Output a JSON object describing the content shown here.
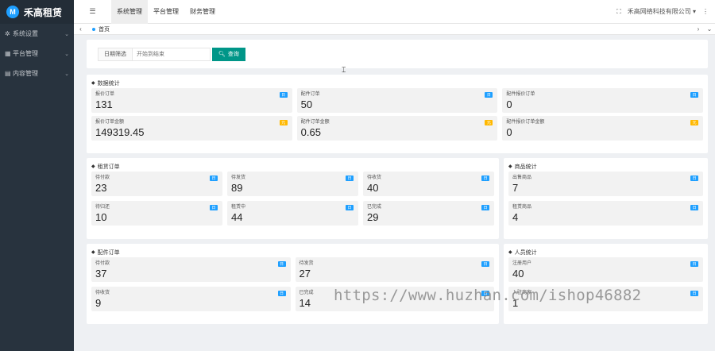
{
  "app": {
    "logo_text": "禾高租赁",
    "logo_mark": "M"
  },
  "sidebar": {
    "items": [
      {
        "label": "系统设置",
        "icon": "gear-icon",
        "glyph": "✲"
      },
      {
        "label": "平台管理",
        "icon": "panel-icon",
        "glyph": "▦"
      },
      {
        "label": "内容管理",
        "icon": "folder-icon",
        "glyph": "▤"
      }
    ]
  },
  "topbar": {
    "menu_glyph": "☰",
    "tabs": [
      "系统管理",
      "平台管理",
      "财务管理"
    ],
    "fullscreen_glyph": "⛶",
    "user": "禾高网络科技有限公司 ▾",
    "more_glyph": "⋮"
  },
  "tabbar": {
    "left_glyph": "‹",
    "tab": "首页",
    "right_glyph": "›",
    "menu_glyph": "⌄"
  },
  "search": {
    "label": "日期筛选",
    "placeholder": "开始到结束",
    "button": "查询",
    "button_glyph": "🔍︎"
  },
  "colors": {
    "sidebar": "#28333e",
    "accent": "#009688",
    "badge_blue": "#1e9fff",
    "badge_orange": "#ffb800"
  },
  "data_stats": {
    "title": "数据统计",
    "items": [
      {
        "label": "报价订单",
        "value": "131",
        "badge": "日"
      },
      {
        "label": "配件订单",
        "value": "50",
        "badge": "日"
      },
      {
        "label": "配件报价订单",
        "value": "0",
        "badge": "日"
      },
      {
        "label": "报价订单金额",
        "value": "149319.45",
        "badge": "元"
      },
      {
        "label": "配件订单金额",
        "value": "0.65",
        "badge": "元"
      },
      {
        "label": "配件报价订单金额",
        "value": "0",
        "badge": "元"
      }
    ]
  },
  "rent_orders": {
    "title": "租赁订单",
    "items": [
      {
        "label": "待付款",
        "value": "23",
        "badge": "日"
      },
      {
        "label": "待发货",
        "value": "89",
        "badge": "日"
      },
      {
        "label": "待收货",
        "value": "40",
        "badge": "日"
      },
      {
        "label": "待归还",
        "value": "10",
        "badge": "日"
      },
      {
        "label": "租赁中",
        "value": "44",
        "badge": "日"
      },
      {
        "label": "已完成",
        "value": "29",
        "badge": "日"
      }
    ]
  },
  "goods_stats": {
    "title": "商品统计",
    "items": [
      {
        "label": "出售商品",
        "value": "7",
        "badge": "日"
      },
      {
        "label": "租赁商品",
        "value": "4",
        "badge": "日"
      }
    ]
  },
  "parts_orders": {
    "title": "配件订单",
    "items": [
      {
        "label": "待付款",
        "value": "37",
        "badge": "日"
      },
      {
        "label": "待发货",
        "value": "27",
        "badge": "日"
      },
      {
        "label": "待收货",
        "value": "9",
        "badge": "日"
      },
      {
        "label": "已完成",
        "value": "14",
        "badge": "日"
      }
    ]
  },
  "user_stats": {
    "title": "人员统计",
    "items": [
      {
        "label": "注册用户",
        "value": "40",
        "badge": "日"
      },
      {
        "label": "入驻商家",
        "value": "1",
        "badge": "日"
      }
    ]
  },
  "overlay": {
    "watermark": "https://www.huzhan.com/ishop46882"
  }
}
